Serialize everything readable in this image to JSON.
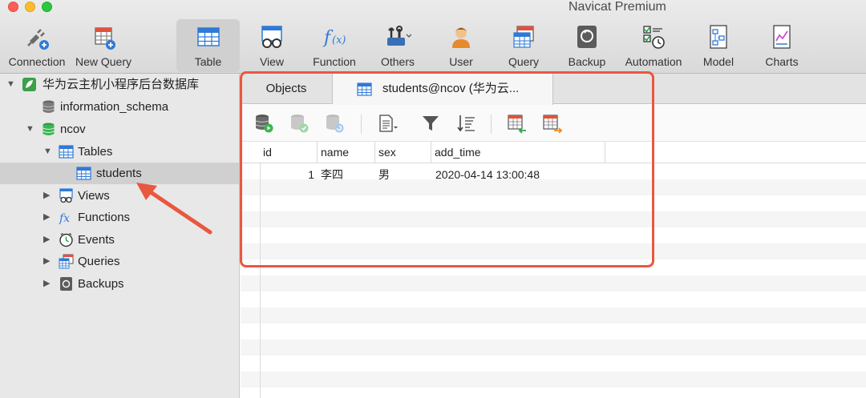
{
  "app": {
    "title": "Navicat Premium"
  },
  "toolbar": {
    "items": [
      {
        "label": "Connection",
        "icon": "connection-plug-icon"
      },
      {
        "label": "New Query",
        "icon": "new-query-icon"
      },
      {
        "label": "Table",
        "icon": "table-icon",
        "active": true
      },
      {
        "label": "View",
        "icon": "view-icon"
      },
      {
        "label": "Function",
        "icon": "function-icon"
      },
      {
        "label": "Others",
        "icon": "others-tools-icon"
      },
      {
        "label": "User",
        "icon": "user-icon"
      },
      {
        "label": "Query",
        "icon": "query-icon"
      },
      {
        "label": "Backup",
        "icon": "backup-icon"
      },
      {
        "label": "Automation",
        "icon": "automation-icon"
      },
      {
        "label": "Model",
        "icon": "model-icon"
      },
      {
        "label": "Charts",
        "icon": "charts-icon"
      }
    ]
  },
  "sidebar": {
    "connection": {
      "label": "华为云主机小程序后台数据库"
    },
    "databases": [
      {
        "label": "information_schema"
      },
      {
        "label": "ncov"
      }
    ],
    "ncov_children": {
      "tables": {
        "label": "Tables"
      },
      "students": {
        "label": "students"
      },
      "views": {
        "label": "Views"
      },
      "functions": {
        "label": "Functions"
      },
      "events": {
        "label": "Events"
      },
      "queries": {
        "label": "Queries"
      },
      "backups": {
        "label": "Backups"
      }
    }
  },
  "tabs": {
    "objects": "Objects",
    "active": "students@ncov (华为云..."
  },
  "grid": {
    "columns": [
      "id",
      "name",
      "sex",
      "add_time"
    ],
    "rows": [
      {
        "id": "1",
        "name": "李四",
        "sex": "男",
        "add_time": "2020-04-14 13:00:48"
      }
    ]
  },
  "colors": {
    "highlight": "#e9573f",
    "accent": "#2f7ad8"
  }
}
